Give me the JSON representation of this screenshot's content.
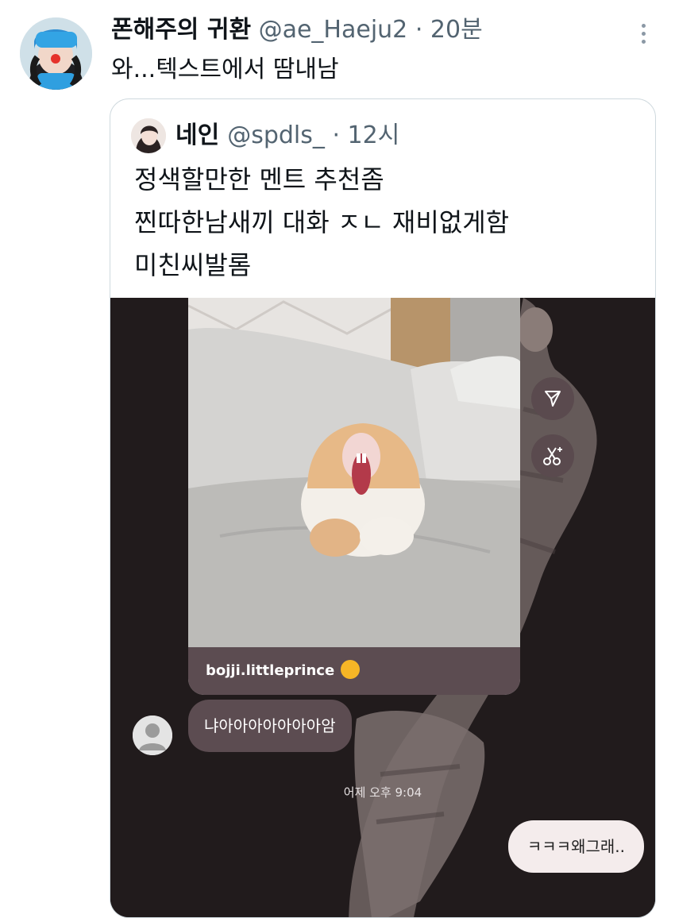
{
  "tweet": {
    "author_name": "폰해주의 귀환",
    "author_handle": "@ae_Haeju2",
    "separator": "·",
    "time": "20분",
    "text": "와...텍스트에서 땀내남"
  },
  "quote": {
    "author_name": "네인",
    "author_handle": "@spdls_",
    "separator": "·",
    "time": "12시",
    "lines": [
      "정색할만한 멘트 추천좀",
      "찐따한남새끼 대화 ㅈㄴ 재비없게함",
      "미친씨발롬"
    ]
  },
  "chat": {
    "caption_user": "bojji.littleprince",
    "received_message": "냐아아아아아아아암",
    "timestamp": "어제 오후 9:04",
    "sent_message": "ㅋㅋㅋ왜그래.."
  },
  "icons": {
    "more": "more-vertical-icon",
    "share": "send-icon",
    "cut": "scissors-sparkle-icon",
    "avatar": "default-user-icon"
  },
  "colors": {
    "chat_background": "#211b1c",
    "bubble_received": "#5c4c51",
    "bubble_sent": "#f4ecec",
    "handle_gray": "#536471"
  }
}
